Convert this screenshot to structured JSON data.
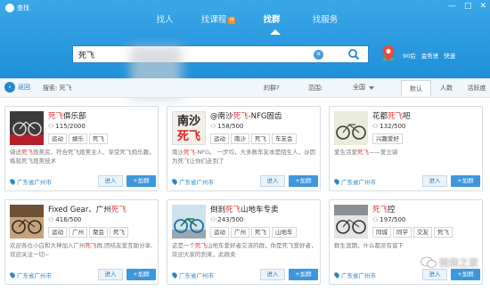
{
  "app": {
    "title": "查找"
  },
  "window_controls": [
    "—",
    "□",
    "✕"
  ],
  "nav": {
    "tabs": [
      {
        "label": "找人",
        "active": false,
        "badge": ""
      },
      {
        "label": "找课程",
        "active": false,
        "badge": "H"
      },
      {
        "label": "找群",
        "active": true,
        "badge": ""
      },
      {
        "label": "找服务",
        "active": false,
        "badge": ""
      }
    ]
  },
  "search": {
    "value": "死飞",
    "placeholder": ""
  },
  "top_right": {
    "level": "90后",
    "rich": "金秀贤",
    "fast": "快速"
  },
  "filter": {
    "back_label": "返回",
    "search_label": "搜索: 死飞",
    "my_query": "的群?",
    "range_label": "范围:",
    "range_value": "全国",
    "sort_tabs": [
      "默认",
      "人数",
      "活跃度"
    ],
    "active_sort": "默认"
  },
  "cards": [
    {
      "name_pre": "",
      "name_hl": "死飞",
      "name_post": "俱乐部",
      "members": "115/2000",
      "tags": [
        "运动",
        "娱乐",
        "死飞"
      ],
      "desc_pre": "骑适",
      "desc_hl": "死飞",
      "desc_post": "炮美房，符合死飞炮美主人、享受死飞炮乐趣，练就死飞炮美技术",
      "location": "广东省广州市",
      "enter": "进入",
      "join": "+加群"
    },
    {
      "name_pre": "@南沙",
      "name_hl": "死飞",
      "name_post": "-NFG固齿",
      "members": "158/500",
      "tags": [
        "运动",
        "南沙",
        "死飞",
        "车友会"
      ],
      "desc_pre": "南沙",
      "desc_hl": "死飞",
      "desc_post": "-NFG。 一步均，大多数车友本是陌生人，@因为死飞让你们走到了",
      "location": "广东省广州市",
      "enter": "进入",
      "join": "+加群"
    },
    {
      "name_pre": "花都",
      "name_hl": "死飞",
      "name_post": "吧",
      "members": "132/500",
      "tags": [
        "兴趣爱好"
      ],
      "desc_pre": "爱生活爱",
      "desc_hl": "死飞",
      "desc_post": "——爱立骑",
      "location": "广东省广州市",
      "enter": "进入",
      "join": "+加群"
    },
    {
      "name_pre": "Fixed Gear、广州",
      "name_hl": "死飞",
      "name_post": "",
      "members": "416/500",
      "tags": [
        "运动",
        "广州",
        "聚会",
        "死飞"
      ],
      "desc_pre": "欢迎各位小白和大神加入广州",
      "desc_hl": "死飞",
      "desc_post": "群,团结友爱互助分享,欢迎关注一切~",
      "location": "广东省广州市",
      "enter": "进入",
      "join": "+加群"
    },
    {
      "name_pre": "倒刹",
      "name_hl": "死飞",
      "name_post": "山地车专卖",
      "members": "243/500",
      "tags": [
        "运动",
        "广州",
        "死飞",
        "山地车"
      ],
      "desc_pre": "这是一个",
      "desc_hl": "死飞",
      "desc_post": "山地车爱好者交流的群，你是死飞爱好者，欢迎大家的到来，此群卖",
      "location": "广东省广州市",
      "enter": "进入",
      "join": "+加群"
    },
    {
      "name_pre": "",
      "name_hl": "死飞",
      "name_post": "控",
      "members": "197/500",
      "tags": [
        "同城",
        "同学",
        "交友",
        "死飞"
      ],
      "desc_pre": "群生涯期，什么都没有留下",
      "desc_hl": "",
      "desc_post": "",
      "location": "广东省广州市",
      "enter": "进入",
      "join": "+加群"
    }
  ],
  "avatar_labels": {
    "card2": [
      "南沙",
      "死飞"
    ]
  },
  "watermark": "微商之家",
  "colors": {
    "header": "#2a95dd",
    "highlight": "#e53333",
    "join_button": "#3d97dd",
    "link": "#2a86c8"
  }
}
